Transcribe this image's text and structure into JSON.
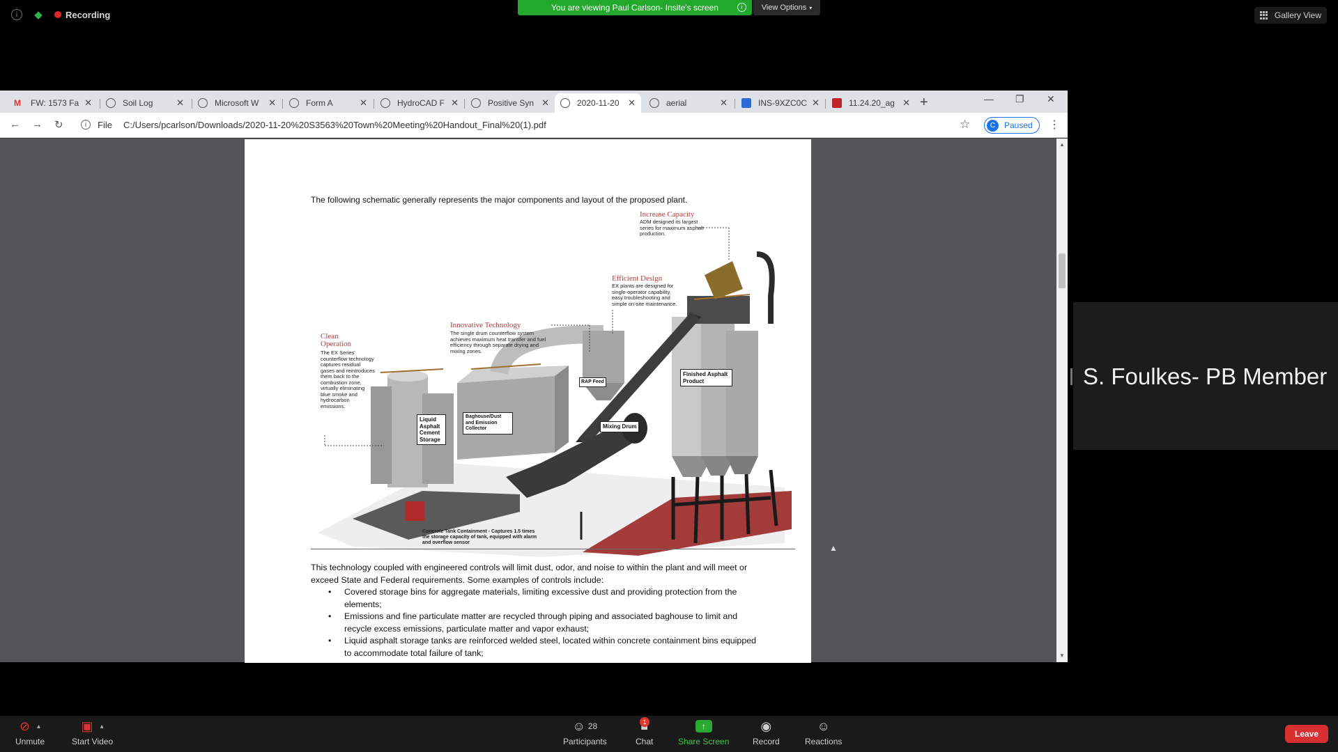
{
  "zoom": {
    "recording_label": "Recording",
    "banner_text": "You are viewing Paul Carlson- Insite's screen",
    "view_options_label": "View Options",
    "gallery_view_label": "Gallery View",
    "participant_name": "S. Foulkes- PB Member",
    "toolbar": {
      "unmute": "Unmute",
      "start_video": "Start Video",
      "participants": "Participants",
      "participants_count": "28",
      "chat": "Chat",
      "chat_badge": "1",
      "share_screen": "Share Screen",
      "record": "Record",
      "reactions": "Reactions",
      "leave": "Leave"
    }
  },
  "browser": {
    "tabs": [
      {
        "label": "FW: 1573 Fa",
        "icon": "gmail-icon"
      },
      {
        "label": "Soil Log",
        "icon": "globe-icon"
      },
      {
        "label": "Microsoft W",
        "icon": "globe-icon"
      },
      {
        "label": "Form A",
        "icon": "globe-icon"
      },
      {
        "label": "HydroCAD F",
        "icon": "globe-icon"
      },
      {
        "label": "Positive Syn",
        "icon": "globe-icon"
      },
      {
        "label": "2020-11-20",
        "icon": "globe-icon"
      },
      {
        "label": "aerial",
        "icon": "globe-icon"
      },
      {
        "label": "INS-9XZC0C",
        "icon": "app-icon"
      },
      {
        "label": "11.24.20_ag",
        "icon": "app-icon"
      }
    ],
    "active_tab_index": 6,
    "url_scheme": "File",
    "url": "C:/Users/pcarlson/Downloads/2020-11-20%20S3563%20Town%20Meeting%20Handout_Final%20(1).pdf",
    "profile_initial": "C",
    "profile_status": "Paused"
  },
  "pdf": {
    "intro": "The following schematic generally represents the major components and layout of the proposed plant.",
    "figure": {
      "callouts": [
        {
          "title": "Increase Capacity",
          "text": "ADM designed its largest series for maximum asphalt production."
        },
        {
          "title": "Efficient Design",
          "text": "EX plants are designed for single-operator capability, easy troubleshooting and simple on-site maintenance."
        },
        {
          "title": "Innovative Technology",
          "text": "The single drum counterflow system achieves maximum heat transfer and fuel efficiency through separate drying and mixing zones."
        },
        {
          "title": "Clean Operation",
          "text": "The EX Series' counterflow technology captures residual gases and reintroduces them back to the combustion zone, virtually eliminating blue smoke and hydrocarbon emissions."
        }
      ],
      "labels": {
        "rap_feed": "RAP Feed",
        "finished": "Finished Asphalt Product",
        "baghouse": "Baghouse/Dust and Emission Collector",
        "liquid": "Liquid Asphalt Cement Storage",
        "mixing": "Mixing Drum",
        "tank": "Concrete Tank Containment - Captures 1.5 times the storage capacity of tank, equipped with alarm and overflow sensor"
      }
    },
    "paragraph": "This technology coupled with engineered controls will limit dust, odor, and noise to within the plant and will meet or exceed State and Federal requirements.  Some examples of controls include:",
    "bullets": [
      "Covered storage bins for aggregate materials, limiting excessive dust and providing protection from the elements;",
      "Emissions and fine particulate matter are recycled through piping and associated baghouse to limit and recycle excess emissions, particulate matter and vapor exhaust;",
      "Liquid asphalt storage tanks are reinforced welded steel, located within concrete containment bins equipped to accommodate total failure of tank;"
    ]
  },
  "colors": {
    "banner_green": "#22a82b",
    "leave_red": "#d83030",
    "callout_red": "#b33b3b",
    "chrome_blue": "#1a73e8"
  }
}
